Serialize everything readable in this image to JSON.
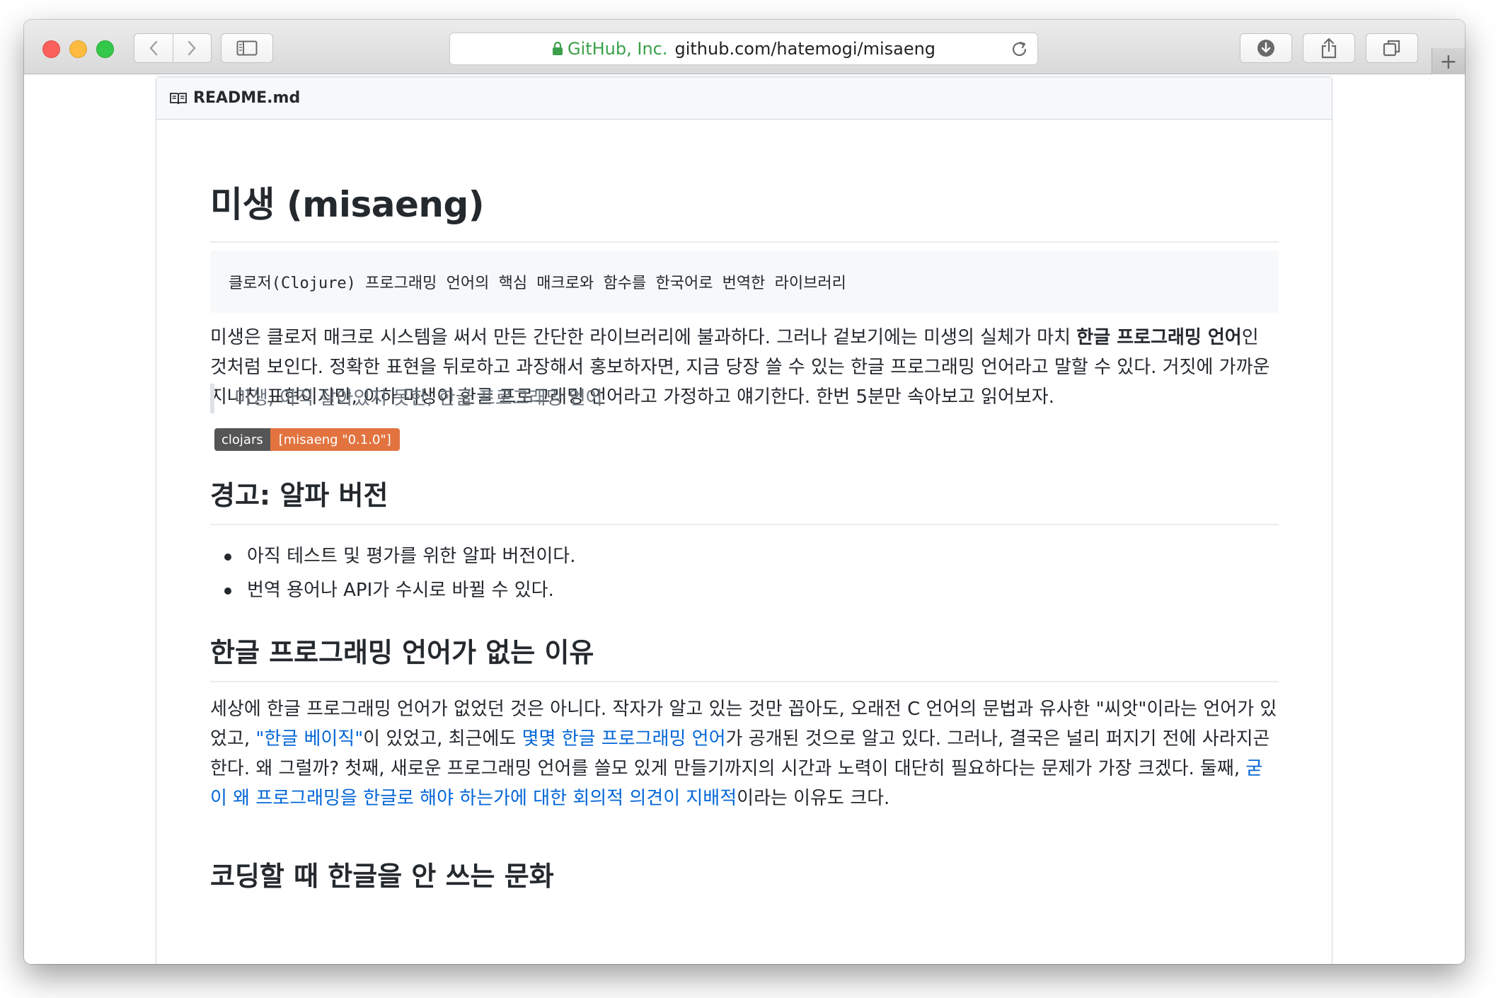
{
  "browser": {
    "address_org": "GitHub, Inc.",
    "address_url": "github.com/hatemogi/misaeng",
    "new_tab_label": "+"
  },
  "readme": {
    "filename": "README.md",
    "title": "미생 (misaeng)",
    "code_line": "클로저(Clojure) 프로그래밍 언어의 핵심 매크로와 함수를 한국어로 번역한 라이브러리",
    "intro_part1": "미생은 클로저 매크로 시스템을 써서 만든 간단한 라이브러리에 불과하다. 그러나 겉보기에는 미생의 실체가 마치 ",
    "intro_bold": "한글 프로그래밍 언어",
    "intro_part2": "인 것처럼 보인다. 정확한 표현을 뒤로하고 과장해서 홍보하자면, 지금 당장 쓸 수 있는 한글 프로그래밍 언어라고 말할 수 있다. 거짓에 가까운 지나친 표현이지만, 이하 미생이 한글 프로그래밍 언어라고 가정하고 얘기한다. 한번 5분만 속아보고 읽어보자.",
    "quote": "미생, 아직 살아있지 못한, 한글 프로그래밍 언어",
    "badge_left": "clojars",
    "badge_right": "[misaeng \"0.1.0\"]",
    "warning_heading": "경고: 알파 버전",
    "warning_items": [
      "아직 테스트 및 평가를 위한 알파 버전이다.",
      "번역 용어나 API가 수시로 바뀔 수 있다."
    ],
    "reason_heading": "한글 프로그래밍 언어가 없는 이유",
    "reason_part1": "세상에 한글 프로그래밍 언어가 없었던 것은 아니다. 작자가 알고 있는 것만 꼽아도, 오래전 C 언어의 문법과 유사한 \"씨앗\"이라는 언어가 있었고, ",
    "reason_link1": "\"한글 베이직\"",
    "reason_part2": "이 있었고, 최근에도 ",
    "reason_link2": "몇몇 한글 프로그래밍 언어",
    "reason_part3": "가 공개된 것으로 알고 있다. 그러나, 결국은 널리 퍼지기 전에 사라지곤 한다. 왜 그럴까? 첫째, 새로운 프로그래밍 언어를 쓸모 있게 만들기까지의 시간과 노력이 대단히 필요하다는 문제가 가장 크겠다. 둘째, ",
    "reason_link3": "굳이 왜 프로그래밍을 한글로 해야 하는가에 대한 회의적 의견이 지배적",
    "reason_part4": "이라는 이유도 크다.",
    "culture_heading": "코딩할 때 한글을 안 쓰는 문화"
  }
}
